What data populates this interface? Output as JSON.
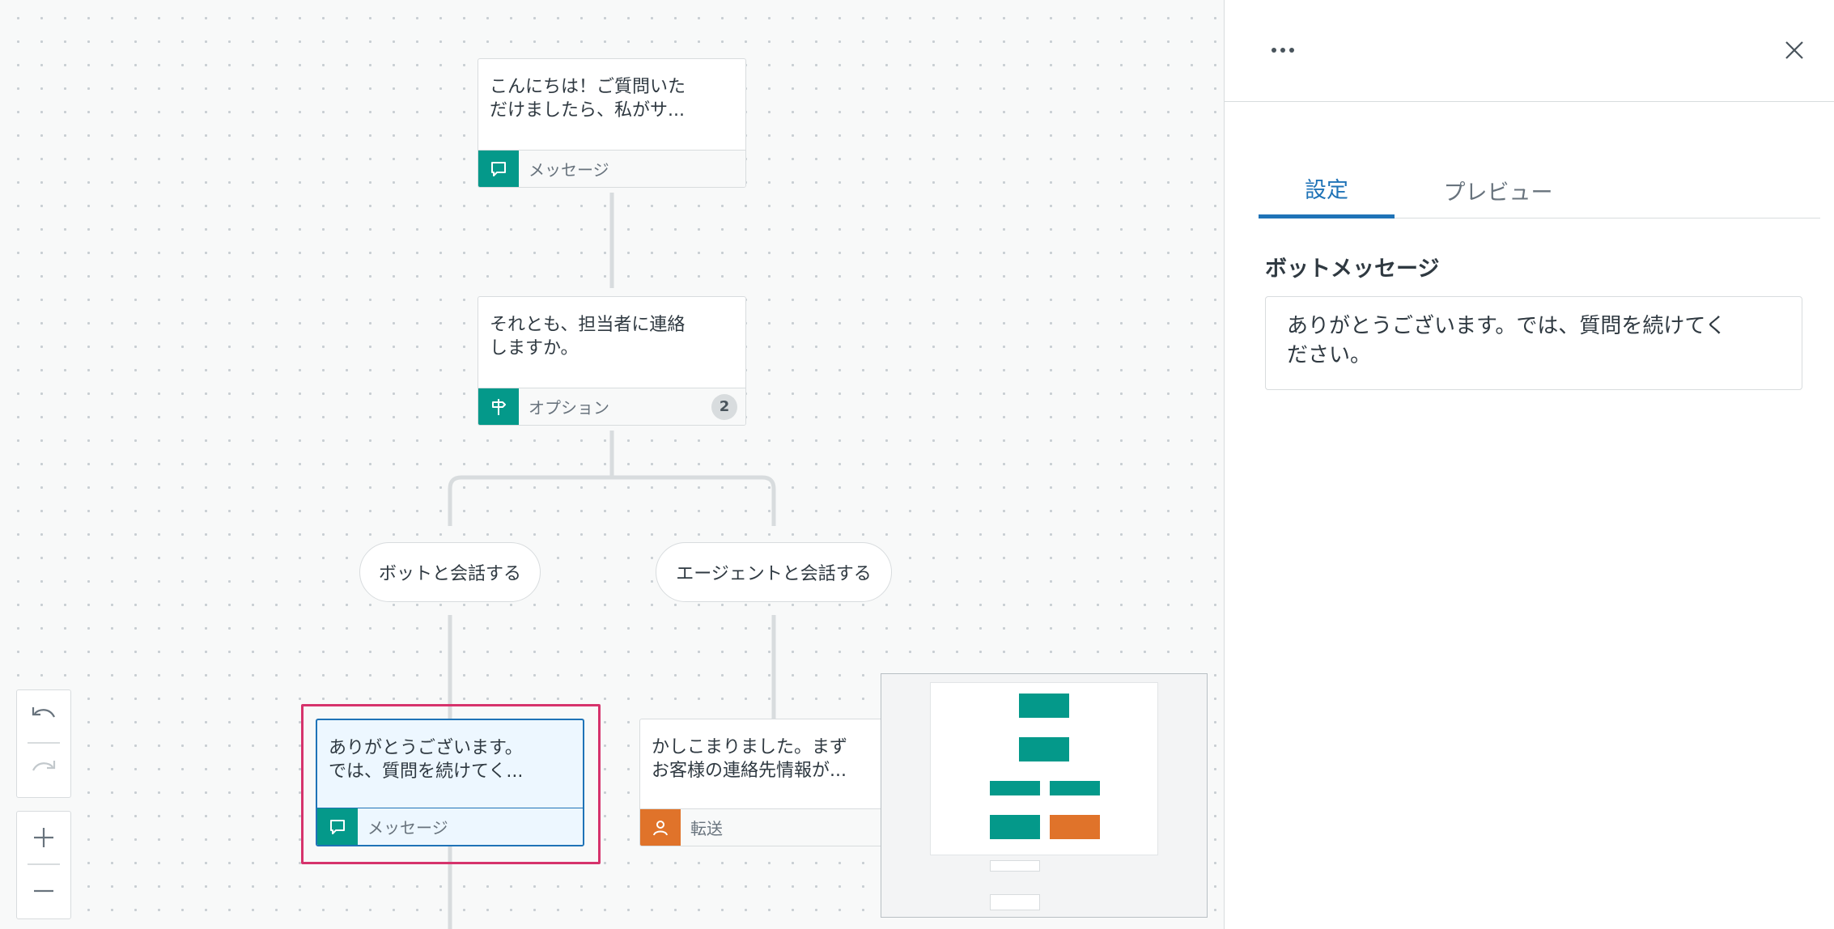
{
  "canvas": {
    "nodes": [
      {
        "text": "こんにちは！ご質問いた\nだけましたら、私がサ...",
        "footer_label": "メッセージ",
        "icon": "speech-bubble-icon"
      },
      {
        "text": "それとも、担当者に連絡\nしますか。",
        "footer_label": "オプション",
        "icon": "signpost-icon",
        "badge": "2"
      },
      {
        "text": "ありがとうございます。\nでは、質問を続けてく...",
        "footer_label": "メッセージ",
        "icon": "speech-bubble-icon"
      },
      {
        "text": "かしこまりました。まず\nお客様の連絡先情報が...",
        "footer_label": "転送",
        "icon": "person-icon"
      }
    ],
    "options": [
      {
        "label": "ボットと会話する"
      },
      {
        "label": "エージェントと会話する"
      }
    ],
    "colors": {
      "message": "#04998a",
      "transfer": "#e0732a",
      "selected_border": "#1f73b7",
      "highlight": "#d6336c"
    }
  },
  "panel": {
    "tabs": [
      {
        "label": "設定",
        "active": true
      },
      {
        "label": "プレビュー",
        "active": false
      }
    ],
    "section_title": "ボットメッセージ",
    "message_value": "ありがとうございます。では、質問を続けてく\nださい。"
  }
}
